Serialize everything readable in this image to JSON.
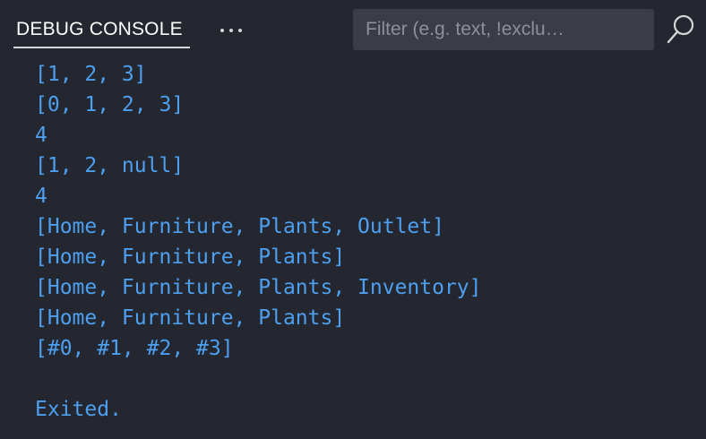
{
  "header": {
    "tab_label": "DEBUG CONSOLE",
    "filter_placeholder": "Filter (e.g. text, !exclu…",
    "filter_value": ""
  },
  "icons": {
    "more": "ellipsis-icon",
    "search": "search-icon"
  },
  "colors": {
    "background": "#24272f",
    "output_text": "#4d9ff0",
    "filter_background": "#3a3d45"
  },
  "console": {
    "lines": [
      "[1, 2, 3]",
      "[0, 1, 2, 3]",
      "4",
      "[1, 2, null]",
      "4",
      "[Home, Furniture, Plants, Outlet]",
      "[Home, Furniture, Plants]",
      "[Home, Furniture, Plants, Inventory]",
      "[Home, Furniture, Plants]",
      "[#0, #1, #2, #3]",
      "",
      "Exited."
    ]
  }
}
